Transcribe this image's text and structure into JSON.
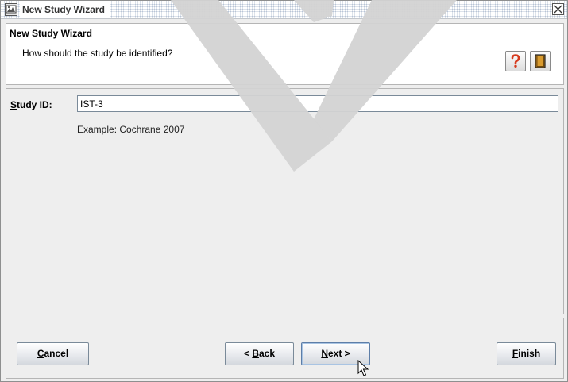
{
  "window": {
    "title": "New Study Wizard"
  },
  "header": {
    "title": "New Study Wizard",
    "subtitle": "How should the study be identified?"
  },
  "form": {
    "study_id_label_mnemonic": "S",
    "study_id_label_rest": "tudy ID:",
    "study_id_value": "IST-3",
    "example_text": "Example: Cochrane 2007"
  },
  "buttons": {
    "cancel_mnemonic": "C",
    "cancel_rest": "ancel",
    "back_prefix": "< ",
    "back_mnemonic": "B",
    "back_rest": "ack",
    "next_mnemonic": "N",
    "next_rest": "ext >",
    "finish_mnemonic": "F",
    "finish_rest": "inish"
  },
  "icons": {
    "app": "wizard-app-icon",
    "close": "close-icon",
    "help": "question-mark-icon",
    "book": "book-icon"
  },
  "colors": {
    "help_icon": "#d63a1e",
    "book_icon": "#b07820",
    "watermark": "#d3d3d3"
  }
}
